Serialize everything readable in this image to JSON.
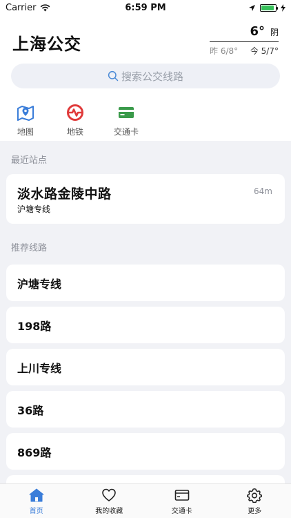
{
  "status_bar": {
    "carrier": "Carrier",
    "time": "6:59 PM",
    "battery_level": 0.9
  },
  "header": {
    "title": "上海公交"
  },
  "weather": {
    "temperature": "6°",
    "condition": "阴",
    "yesterday": "昨 6/8°",
    "today": "今 5/7°"
  },
  "search": {
    "placeholder": "搜索公交线路"
  },
  "shortcuts": [
    {
      "label": "地图",
      "icon": "map-icon"
    },
    {
      "label": "地铁",
      "icon": "metro-icon"
    },
    {
      "label": "交通卡",
      "icon": "transit-card-icon"
    }
  ],
  "recent": {
    "section_label": "最近站点",
    "station": "淡水路金陵中路",
    "line": "沪塘专线",
    "distance": "64m"
  },
  "recommended": {
    "section_label": "推荐线路",
    "routes": [
      "沪塘专线",
      "198路",
      "上川专线",
      "36路",
      "869路"
    ]
  },
  "tab_bar": {
    "tabs": [
      {
        "label": "首页",
        "icon": "home-icon",
        "active": true
      },
      {
        "label": "我的收藏",
        "icon": "heart-icon",
        "active": false
      },
      {
        "label": "交通卡",
        "icon": "card-icon",
        "active": false
      },
      {
        "label": "更多",
        "icon": "gear-icon",
        "active": false
      }
    ]
  },
  "colors": {
    "accent": "#3a7dd9",
    "metro_red": "#e03a3a",
    "card_green": "#3a9a4a",
    "background_grey": "#f1f2f6"
  }
}
